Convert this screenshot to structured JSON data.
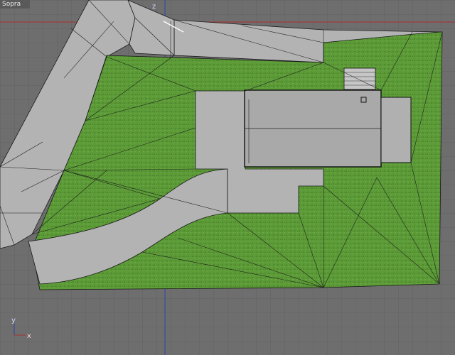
{
  "viewport": {
    "view_name": "Sopra",
    "axis_labels": {
      "z": "z",
      "x": "x",
      "y": "y"
    }
  },
  "colors": {
    "background": "#6e6e6e",
    "grid_minor": "#636363",
    "grid_major": "#5a5a5a",
    "x_axis": "#9e3b3b",
    "y_axis": "#3a4aa0",
    "z_axis": "#3a4aa0",
    "terrain_grass": "#5a9a35",
    "terrain_gray": "#b3b3b3",
    "roof": "#a9a9a9",
    "mesh_lines": "#1a1a1a"
  },
  "icons": [
    "axis-gizmo-icon"
  ]
}
